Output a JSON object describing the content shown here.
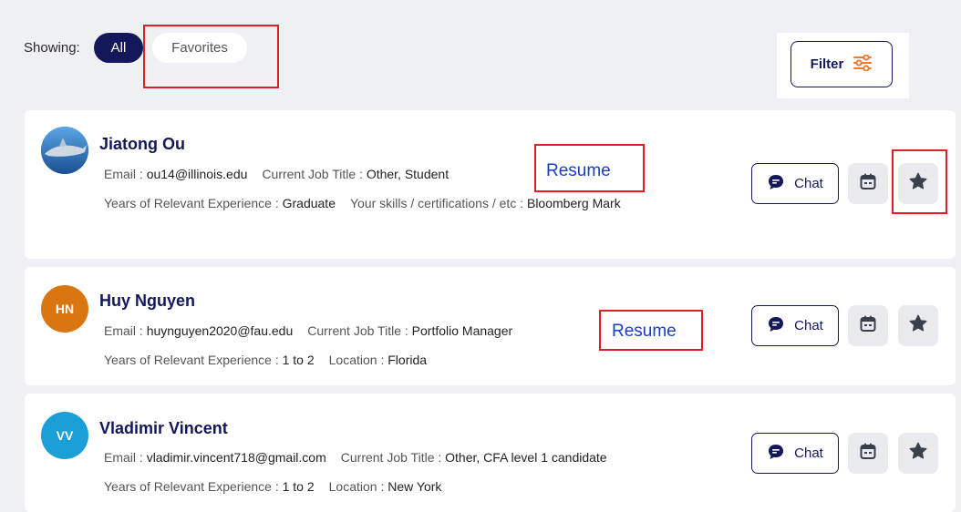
{
  "filter_bar": {
    "showing_label": "Showing:",
    "all_label": "All",
    "favorites_label": "Favorites",
    "filter_label": "Filter"
  },
  "labels": {
    "email": "Email : ",
    "job_title": "Current Job Title : ",
    "experience": "Years of Relevant Experience : ",
    "skills": "Your skills / certifications / etc : ",
    "location": "Location : ",
    "resume": "Resume",
    "chat": "Chat"
  },
  "candidates": [
    {
      "name": "Jiatong Ou",
      "initials": "",
      "avatar": "photo",
      "email": "ou14@illinois.edu",
      "job_title": "Other, Student",
      "experience": "Graduate",
      "skills": "Bloomberg Mark"
    },
    {
      "name": "Huy Nguyen",
      "initials": "HN",
      "avatar_color": "#d9760f",
      "email": "huynguyen2020@fau.edu",
      "job_title": "Portfolio Manager",
      "experience": "1 to 2",
      "location": "Florida"
    },
    {
      "name": "Vladimir Vincent",
      "initials": "VV",
      "avatar_color": "#1a9fd6",
      "email": "vladimir.vincent718@gmail.com",
      "job_title": "Other, CFA level 1 candidate",
      "experience": "1 to 2",
      "location": "New York"
    }
  ],
  "colors": {
    "primary": "#14185a",
    "annotation": "#e11d2a",
    "filter_icon": "#f07a2a",
    "resume_link": "#1a3ccf"
  }
}
